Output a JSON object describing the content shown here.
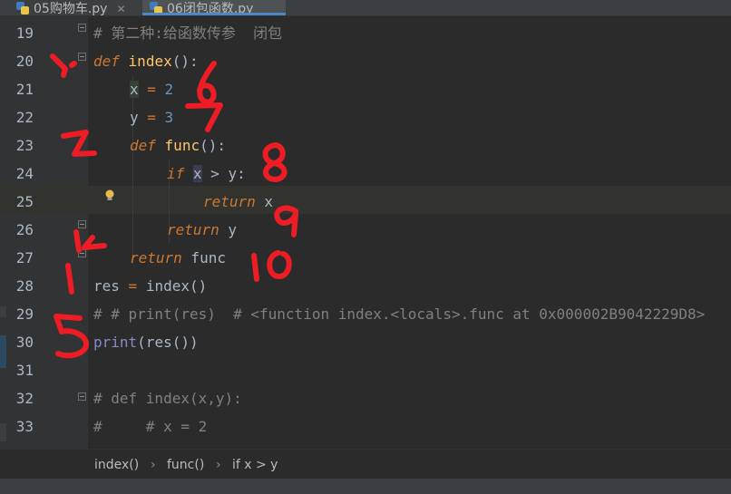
{
  "tabs": [
    {
      "label": "05购物车.py",
      "active": false
    },
    {
      "label": "06闭包函数.py",
      "active": true
    }
  ],
  "lines": [
    {
      "number": "19"
    },
    {
      "number": "20"
    },
    {
      "number": "21"
    },
    {
      "number": "22"
    },
    {
      "number": "23"
    },
    {
      "number": "24"
    },
    {
      "number": "25"
    },
    {
      "number": "26"
    },
    {
      "number": "27"
    },
    {
      "number": "28"
    },
    {
      "number": "29"
    },
    {
      "number": "30"
    },
    {
      "number": "31"
    },
    {
      "number": "32"
    },
    {
      "number": "33"
    }
  ],
  "code": {
    "l19_comment": "# 第二种:给函数传参  闭包",
    "l20_def": "def",
    "l20_name": "index",
    "l20_rest": "():",
    "l21_var": "x",
    "l21_eq": " = ",
    "l21_val": "2",
    "l22_var": "y",
    "l22_eq": " = ",
    "l22_val": "3",
    "l23_def": "def",
    "l23_name": "func",
    "l23_rest": "():",
    "l24_if": "if",
    "l24_x": "x",
    "l24_rest": " > y:",
    "l25_return": "return",
    "l25_x": " x",
    "l26_return": "return",
    "l26_y": " y",
    "l27_return": "return",
    "l27_func": " func",
    "l28_res": "res",
    "l28_eq": " = ",
    "l28_call": "index",
    "l28_paren": "()",
    "l29_comment": "# # print(res)  # <function index.<locals>.func at 0x000002B9042229D8>",
    "l30_print": "print",
    "l30_rest": "(res())",
    "l32_comment": "# def index(x,y):",
    "l33_comment": "#     # x = 2"
  },
  "breadcrumb": {
    "items": [
      "index()",
      "func()",
      "if x > y"
    ],
    "separator": "›"
  },
  "annotations": {
    "color": "#ee1c24",
    "labels": [
      "1",
      "2",
      "3",
      "4",
      "5",
      "6",
      "7",
      "8",
      "9",
      "10"
    ]
  },
  "colors": {
    "background": "#2b2b2b",
    "keyword": "#cc7832",
    "function": "#ffc66d",
    "number": "#6897bb",
    "comment": "#808080",
    "text": "#a9b7c6"
  }
}
